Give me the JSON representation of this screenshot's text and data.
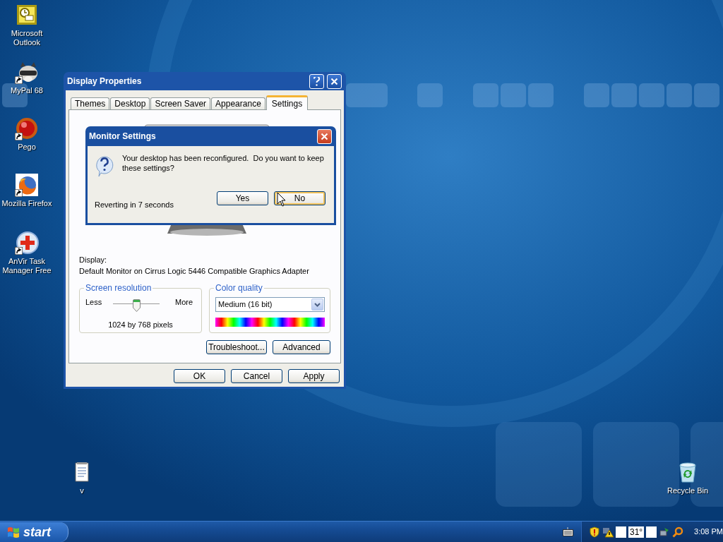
{
  "desktop_icons": [
    {
      "label": "Microsoft Outlook",
      "kind": "outlook",
      "shortcut": false
    },
    {
      "label": "MyPal 68",
      "kind": "mypal",
      "shortcut": true
    },
    {
      "label": "Pego",
      "kind": "pego",
      "shortcut": true
    },
    {
      "label": "Mozilla Firefox",
      "kind": "firefox",
      "shortcut": true
    },
    {
      "label": "AnVir Task Manager Free",
      "kind": "anvir",
      "shortcut": true
    },
    {
      "label": "v",
      "kind": "notepad",
      "shortcut": false
    },
    {
      "label": "Recycle Bin",
      "kind": "recycle",
      "shortcut": false
    }
  ],
  "display_properties": {
    "title": "Display Properties",
    "tabs": [
      {
        "label": "Themes",
        "selected": false
      },
      {
        "label": "Desktop",
        "selected": false
      },
      {
        "label": "Screen Saver",
        "selected": false
      },
      {
        "label": "Appearance",
        "selected": false
      },
      {
        "label": "Settings",
        "selected": true
      }
    ],
    "display_label": "Display:",
    "display_value": "Default Monitor on Cirrus Logic 5446 Compatible Graphics Adapter",
    "screen_resolution": {
      "legend": "Screen resolution",
      "less": "Less",
      "more": "More",
      "level": 0.5,
      "reading": "1024 by 768 pixels"
    },
    "color_quality": {
      "legend": "Color quality",
      "value": "Medium (16 bit)"
    },
    "panel_buttons": [
      "Troubleshoot...",
      "Advanced"
    ],
    "buttons": [
      "OK",
      "Cancel",
      "Apply"
    ]
  },
  "monitor_settings": {
    "title": "Monitor Settings",
    "message": "Your desktop has been reconfigured.  Do you want to keep these settings?",
    "countdown": "Reverting in 7 seconds",
    "buttons": [
      {
        "label": "Yes",
        "hovered": false
      },
      {
        "label": "No",
        "hovered": true
      }
    ]
  },
  "taskbar": {
    "start": "start",
    "temperature": "31°",
    "clock": "3:08 PM"
  }
}
